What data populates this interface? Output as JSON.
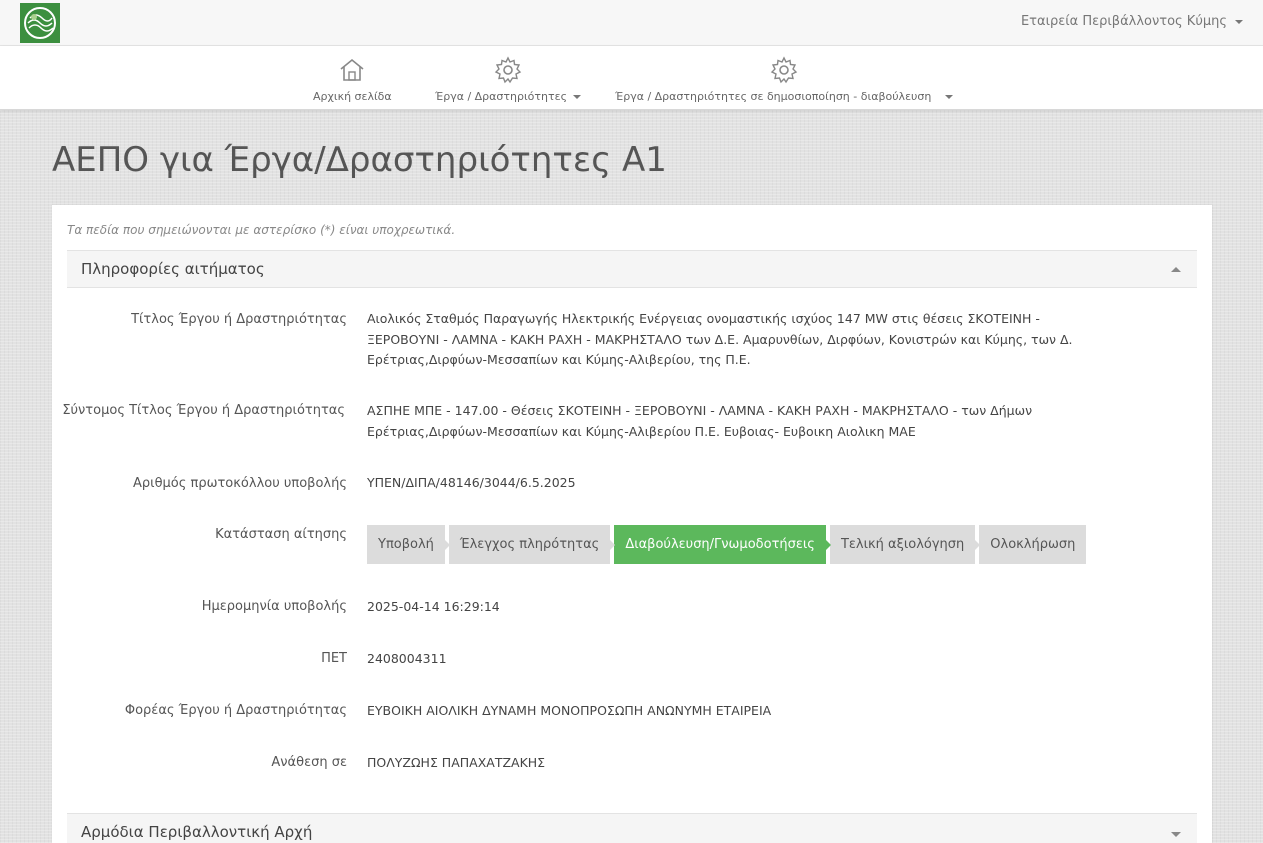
{
  "header": {
    "user_menu": "Εταιρεία Περιβάλλοντος Κύμης"
  },
  "nav": {
    "home": "Αρχική σελίδα",
    "works": "Έργα / Δραστηριότητες",
    "consultation": "Έργα / Δραστηριότητες σε δημοσιοποίηση - διαβούλευση"
  },
  "page": {
    "title": "ΑΕΠΟ για Έργα/Δραστηριότητες Α1",
    "required_note": "Τα πεδία που σημειώνονται με αστερίσκο (*) είναι υποχρεωτικά."
  },
  "section1": {
    "title": "Πληροφορίες αιτήματος"
  },
  "fields": {
    "title_label": "Τίτλος Έργου ή Δραστηριότητας",
    "title_value": "Αιολικός Σταθμός Παραγωγής Ηλεκτρικής Ενέργειας ονομαστικής ισχύος 147 MW στις θέσεις ΣΚΟΤΕΙΝΗ - ΞΕΡΟΒΟΥΝΙ - ΛΑΜΝΑ - ΚΑΚΗ ΡΑΧΗ - ΜΑΚΡΗΣΤΑΛΟ των Δ.Ε. Αμαρυνθίων, Διρφύων, Κονιστρών και Κύμης, των Δ. Ερέτριας,Διρφύων-Μεσσαπίων και Κύμης-Αλιβερίου, της Π.Ε.",
    "short_title_label": "Σύντομος Τίτλος Έργου ή Δραστηριότητας",
    "short_title_value": "ΑΣΠΗΕ ΜΠΕ - 147.00 - Θέσεις ΣΚΟΤΕΙΝΗ - ΞΕΡΟΒΟΥΝΙ - ΛΑΜΝΑ - ΚΑΚΗ ΡΑΧΗ - ΜΑΚΡΗΣΤΑΛΟ - των Δήμων Ερέτριας,Διρφύων-Μεσσαπίων και Κύμης-Αλιβερίου Π.Ε. Ευβοιας- Ευβοικη Αιολικη ΜΑΕ",
    "protocol_label": "Αριθμός πρωτοκόλλου υποβολής",
    "protocol_value": "ΥΠΕΝ/ΔΙΠΑ/48146/3044/6.5.2025",
    "status_label": "Κατάσταση αίτησης",
    "date_label": "Ημερομηνία υποβολής",
    "date_value": "2025-04-14 16:29:14",
    "pet_label": "ΠΕΤ",
    "pet_value": "2408004311",
    "body_label": "Φορέας Έργου ή Δραστηριότητας",
    "body_value": "ΕΥΒΟΙΚΗ ΑΙΟΛΙΚΗ ΔΥΝΑΜΗ ΜΟΝΟΠΡΟΣΩΠΗ ΑΝΩΝΥΜΗ ΕΤΑΙΡΕΙΑ",
    "assigned_label": "Ανάθεση σε",
    "assigned_value": "ΠΟΛΥΖΩΗΣ ΠΑΠΑΧΑΤΖΑΚΗΣ"
  },
  "status_steps": [
    {
      "label": "Υποβολή",
      "active": false
    },
    {
      "label": "Έλεγχος πληρότητας",
      "active": false
    },
    {
      "label": "Διαβούλευση/Γνωμοδοτήσεις",
      "active": true
    },
    {
      "label": "Τελική αξιολόγηση",
      "active": false
    },
    {
      "label": "Ολοκλήρωση",
      "active": false
    }
  ],
  "section2": {
    "title": "Αρμόδια Περιβαλλοντική Αρχή"
  },
  "colors": {
    "active_step": "#5cb85c",
    "inactive_step": "#dcdcdc",
    "logo_green": "#3c8f3f"
  }
}
